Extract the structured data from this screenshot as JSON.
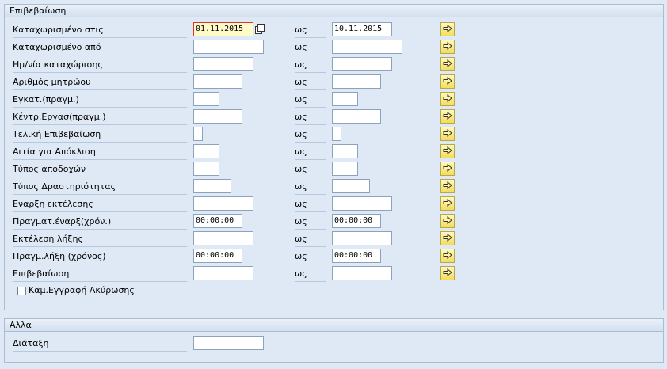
{
  "selection": {
    "title": "Επιβεβαίωση",
    "to_label": "ως",
    "rows": [
      {
        "label": "Καταχωρισμένο στις",
        "from": "01.11.2015",
        "to": "10.11.2015"
      },
      {
        "label": "Καταχωρισμένο από",
        "from": "",
        "to": ""
      },
      {
        "label": "Ημ/νία καταχώρισης",
        "from": "",
        "to": ""
      },
      {
        "label": "Αριθμός μητρώου",
        "from": "",
        "to": ""
      },
      {
        "label": "Εγκατ.(πραγμ.)",
        "from": "",
        "to": ""
      },
      {
        "label": "Κέντρ.Εργασ(πραγμ.)",
        "from": "",
        "to": ""
      },
      {
        "label": "Τελική Επιβεβαίωση",
        "from": "",
        "to": ""
      },
      {
        "label": "Αιτία για Απόκλιση",
        "from": "",
        "to": ""
      },
      {
        "label": "Τύπος αποδοχών",
        "from": "",
        "to": ""
      },
      {
        "label": "Τύπος Δραστηριότητας",
        "from": "",
        "to": ""
      },
      {
        "label": "Εναρξη εκτέλεσης",
        "from": "",
        "to": ""
      },
      {
        "label": "Πραγματ.έναρξ(χρόν.)",
        "from": "00:00:00",
        "to": "00:00:00"
      },
      {
        "label": "Εκτέλεση λήξης",
        "from": "",
        "to": ""
      },
      {
        "label": "Πραγμ.λήξη (χρόνος)",
        "from": "00:00:00",
        "to": "00:00:00"
      },
      {
        "label": "Επιβεβαίωση",
        "from": "",
        "to": ""
      }
    ],
    "checkbox_label": "Καμ.Εγγραφή Ακύρωσης"
  },
  "other": {
    "title": "Αλλα",
    "layout_label": "Διάταξη",
    "layout_value": ""
  },
  "icons": {
    "multiple_selection": "arrow-right-icon",
    "copy": "copy-icon"
  },
  "colors": {
    "background": "#dfe9f5",
    "focus_field": "#fffbc8",
    "selection_button": "#f2dd5c"
  }
}
